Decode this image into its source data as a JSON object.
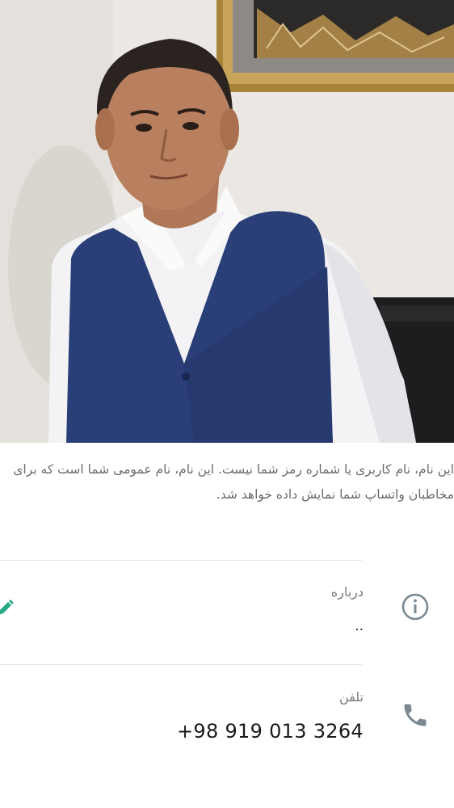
{
  "profile": {
    "name_hint": "این نام، نام کاربری یا شماره رمز شما نیست. این نام، نام عمومی شما است که برای مخاطبان واتساپ شما نمایش داده خواهد شد.",
    "about": {
      "label": "درباره",
      "value": "..",
      "icon": "info-icon"
    },
    "phone": {
      "label": "تلفن",
      "value": "+98 919 013 3264",
      "icon": "phone-icon"
    }
  },
  "colors": {
    "accent": "#25a884",
    "icon_gray": "#7b8a92",
    "label_gray": "#7a7a7a",
    "text_dark": "#1a1a1a"
  }
}
